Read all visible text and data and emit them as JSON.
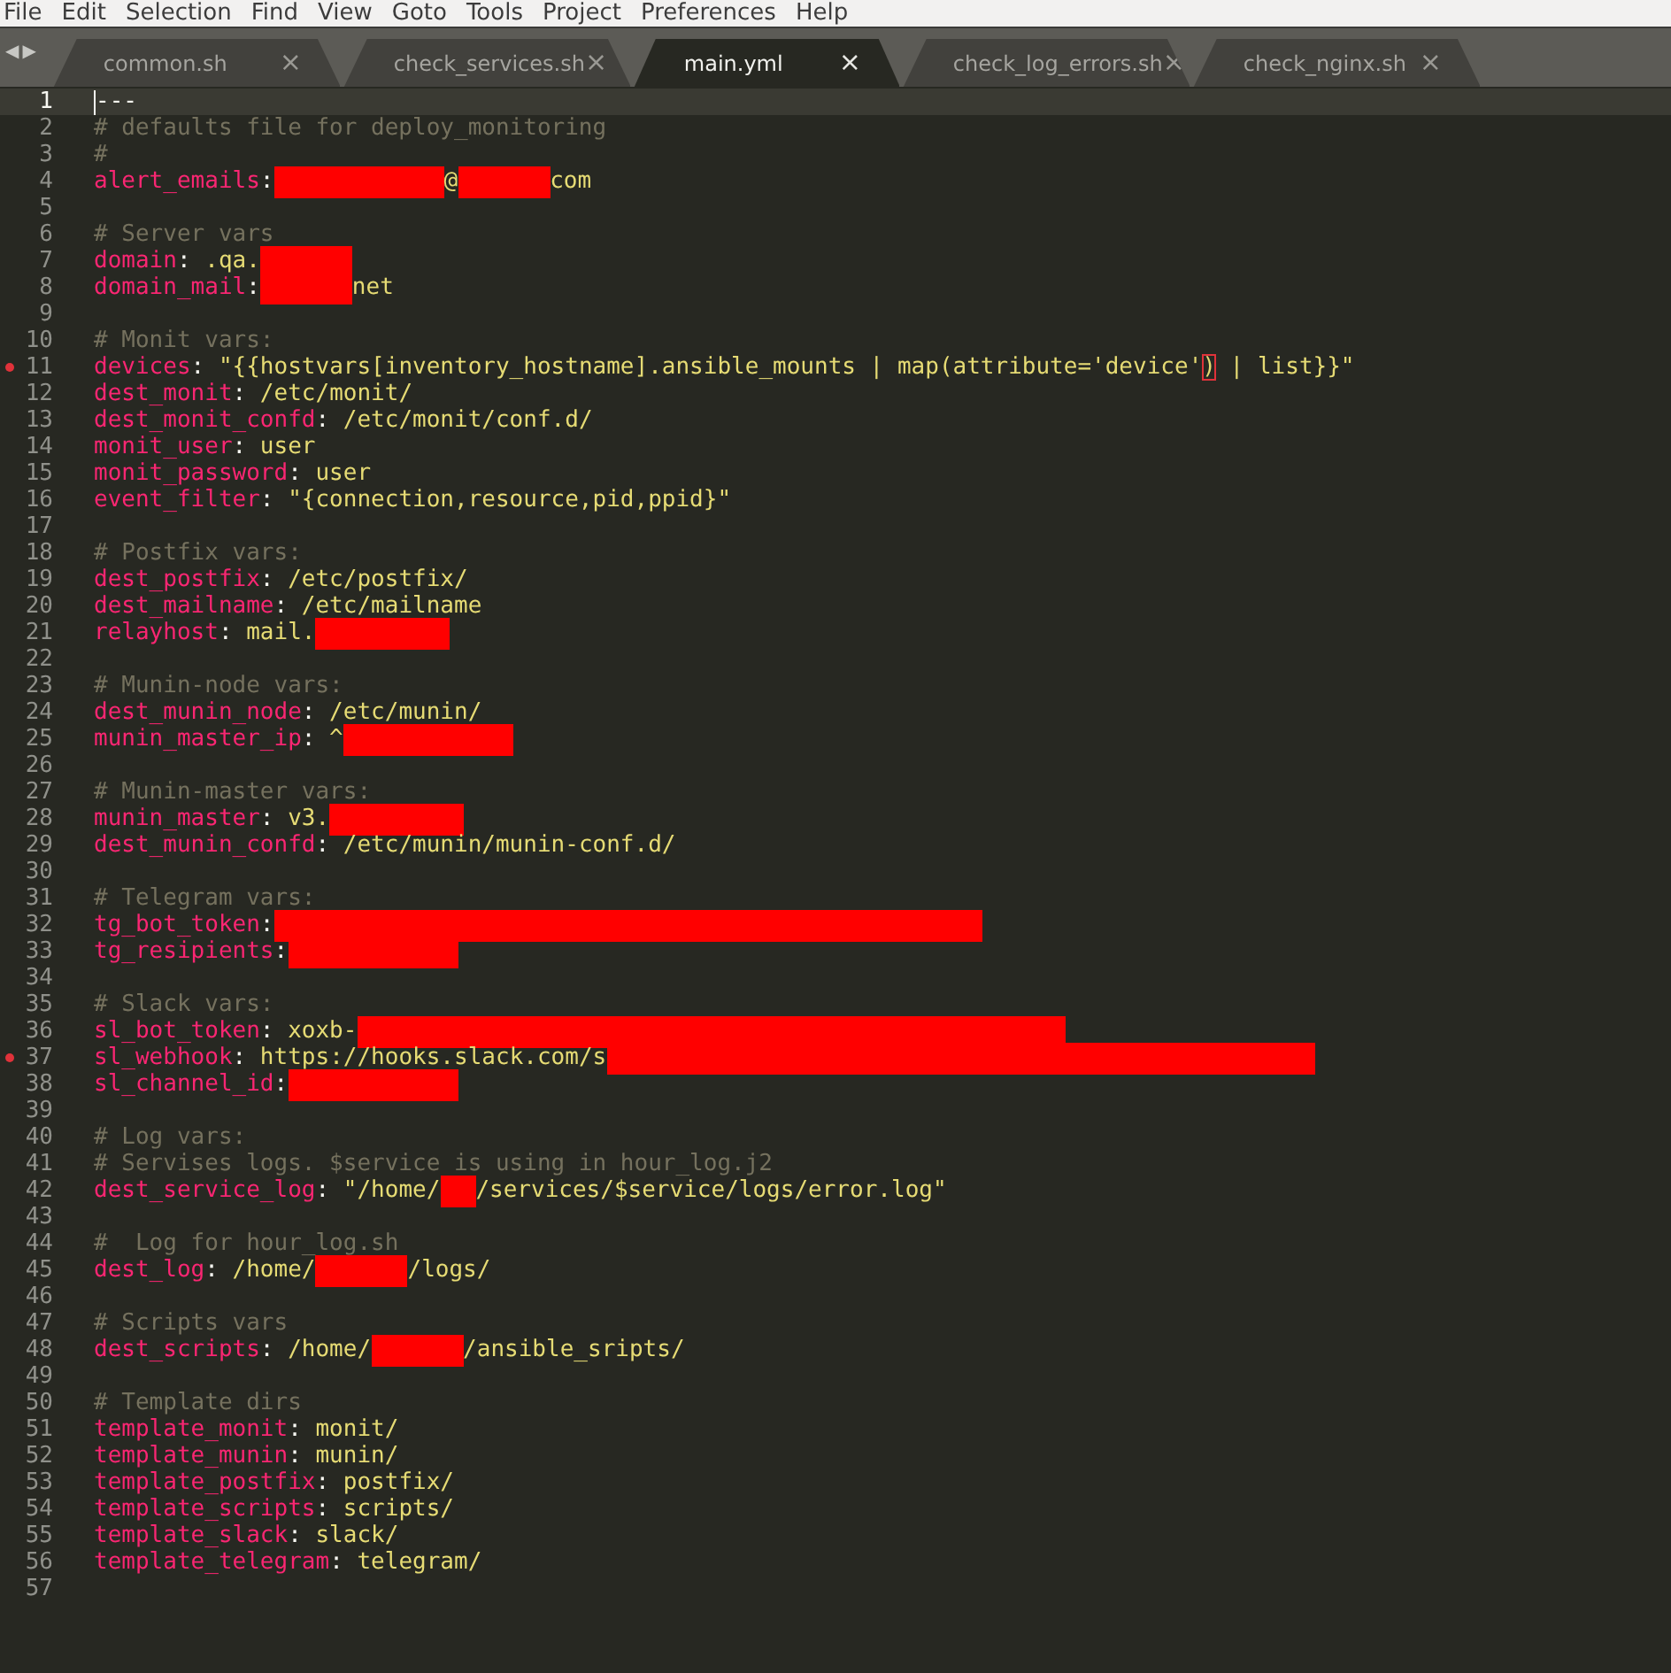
{
  "menu": [
    "File",
    "Edit",
    "Selection",
    "Find",
    "View",
    "Goto",
    "Tools",
    "Project",
    "Preferences",
    "Help"
  ],
  "tab_nav": [
    "◀",
    "▶"
  ],
  "tabs": [
    {
      "label": "common.sh",
      "close": "×",
      "selected": false
    },
    {
      "label": "check_services.sh",
      "close": "×",
      "selected": false
    },
    {
      "label": "main.yml",
      "close": "×",
      "selected": true
    },
    {
      "label": "check_log_errors.sh",
      "close": "×",
      "selected": false
    },
    {
      "label": "check_nginx.sh",
      "close": "×",
      "selected": false
    }
  ],
  "editor": {
    "lines": [
      {
        "number": "1",
        "current": true,
        "segments": [
          {
            "kind": "plain",
            "text": "---"
          }
        ]
      },
      {
        "number": "2",
        "segments": [
          {
            "kind": "comment",
            "text": "# defaults file for deploy_monitoring"
          }
        ]
      },
      {
        "number": "3",
        "segments": [
          {
            "kind": "comment",
            "text": "#"
          }
        ]
      },
      {
        "number": "4",
        "segments": [
          {
            "kind": "key",
            "text": "alert_emails"
          },
          {
            "kind": "punct",
            "text": ":"
          },
          {
            "kind": "redacted-long"
          },
          {
            "kind": "value",
            "text": "@"
          },
          {
            "kind": "redacted-short"
          },
          {
            "kind": "value",
            "text": "com"
          }
        ]
      },
      {
        "number": "5"
      },
      {
        "number": "6",
        "segments": [
          {
            "kind": "comment",
            "text": "# Server vars"
          }
        ]
      },
      {
        "number": "7",
        "segments": [
          {
            "kind": "key",
            "text": "domain"
          },
          {
            "kind": "punct",
            "text": ":"
          },
          {
            "kind": "value",
            "text": " .qa."
          },
          {
            "kind": "redacted-short"
          }
        ]
      },
      {
        "number": "8",
        "segments": [
          {
            "kind": "key",
            "text": "domain_mail"
          },
          {
            "kind": "punct",
            "text": ":"
          },
          {
            "kind": "redacted-short"
          },
          {
            "kind": "value",
            "text": "net"
          }
        ]
      },
      {
        "number": "9"
      },
      {
        "number": "10",
        "segments": [
          {
            "kind": "comment",
            "text": "# Monit vars:"
          }
        ]
      },
      {
        "number": "11",
        "marker": true,
        "segments": [
          {
            "kind": "key",
            "text": "devices"
          },
          {
            "kind": "punct",
            "text": ":"
          },
          {
            "kind": "value",
            "text": " \"{{hostvars[inventory_hostname].ansible_mounts | map(attribute='device'"
          },
          {
            "kind": "bracket",
            "text": ")"
          },
          {
            "kind": "value",
            "text": " | list}}\""
          }
        ]
      },
      {
        "number": "12",
        "segments": [
          {
            "kind": "key",
            "text": "dest_monit"
          },
          {
            "kind": "punct",
            "text": ":"
          },
          {
            "kind": "value",
            "text": " /etc/monit/"
          }
        ]
      },
      {
        "number": "13",
        "segments": [
          {
            "kind": "key",
            "text": "dest_monit_confd"
          },
          {
            "kind": "punct",
            "text": ":"
          },
          {
            "kind": "value",
            "text": " /etc/monit/conf.d/"
          }
        ]
      },
      {
        "number": "14",
        "segments": [
          {
            "kind": "key",
            "text": "monit_user"
          },
          {
            "kind": "punct",
            "text": ":"
          },
          {
            "kind": "value",
            "text": " user"
          }
        ]
      },
      {
        "number": "15",
        "segments": [
          {
            "kind": "key",
            "text": "monit_password"
          },
          {
            "kind": "punct",
            "text": ":"
          },
          {
            "kind": "value",
            "text": " user"
          }
        ]
      },
      {
        "number": "16",
        "segments": [
          {
            "kind": "key",
            "text": "event_filter"
          },
          {
            "kind": "punct",
            "text": ":"
          },
          {
            "kind": "value",
            "text": " \"{connection,resource,pid,ppid}\""
          }
        ]
      },
      {
        "number": "17"
      },
      {
        "number": "18",
        "segments": [
          {
            "kind": "comment",
            "text": "# Postfix vars:"
          }
        ]
      },
      {
        "number": "19",
        "segments": [
          {
            "kind": "key",
            "text": "dest_postfix"
          },
          {
            "kind": "punct",
            "text": ":"
          },
          {
            "kind": "value",
            "text": " /etc/postfix/"
          }
        ]
      },
      {
        "number": "20",
        "segments": [
          {
            "kind": "key",
            "text": "dest_mailname"
          },
          {
            "kind": "punct",
            "text": ":"
          },
          {
            "kind": "value",
            "text": " /etc/mailname"
          }
        ]
      },
      {
        "number": "21",
        "segments": [
          {
            "kind": "key",
            "text": "relayhost"
          },
          {
            "kind": "punct",
            "text": ":"
          },
          {
            "kind": "value",
            "text": " mail."
          },
          {
            "kind": "redacted-medium"
          }
        ]
      },
      {
        "number": "22"
      },
      {
        "number": "23",
        "segments": [
          {
            "kind": "comment",
            "text": "# Munin-node vars:"
          }
        ]
      },
      {
        "number": "24",
        "segments": [
          {
            "kind": "key",
            "text": "dest_munin_node"
          },
          {
            "kind": "punct",
            "text": ":"
          },
          {
            "kind": "value",
            "text": " /etc/munin/"
          }
        ]
      },
      {
        "number": "25",
        "segments": [
          {
            "kind": "key",
            "text": "munin_master_ip"
          },
          {
            "kind": "punct",
            "text": ":"
          },
          {
            "kind": "value",
            "text": " ^"
          },
          {
            "kind": "redacted-long"
          }
        ]
      },
      {
        "number": "26"
      },
      {
        "number": "27",
        "segments": [
          {
            "kind": "comment",
            "text": "# Munin-master vars:"
          }
        ]
      },
      {
        "number": "28",
        "segments": [
          {
            "kind": "key",
            "text": "munin_master"
          },
          {
            "kind": "punct",
            "text": ":"
          },
          {
            "kind": "value",
            "text": " v3."
          },
          {
            "kind": "redacted-medium"
          }
        ]
      },
      {
        "number": "29",
        "segments": [
          {
            "kind": "key",
            "text": "dest_munin_confd"
          },
          {
            "kind": "punct",
            "text": ":"
          },
          {
            "kind": "value",
            "text": " /etc/munin/munin-conf.d/"
          }
        ]
      },
      {
        "number": "30"
      },
      {
        "number": "31",
        "segments": [
          {
            "kind": "comment",
            "text": "# Telegram vars:"
          }
        ]
      },
      {
        "number": "32",
        "segments": [
          {
            "kind": "key",
            "text": "tg_bot_token"
          },
          {
            "kind": "punct",
            "text": ":"
          },
          {
            "kind": "redacted-huge"
          }
        ]
      },
      {
        "number": "33",
        "segments": [
          {
            "kind": "key",
            "text": "tg_resipients"
          },
          {
            "kind": "punct",
            "text": ":"
          },
          {
            "kind": "redacted-long"
          }
        ]
      },
      {
        "number": "34"
      },
      {
        "number": "35",
        "segments": [
          {
            "kind": "comment",
            "text": "# Slack vars:"
          }
        ]
      },
      {
        "number": "36",
        "segments": [
          {
            "kind": "key",
            "text": "sl_bot_token"
          },
          {
            "kind": "punct",
            "text": ":"
          },
          {
            "kind": "value",
            "text": " xoxb-"
          },
          {
            "kind": "redacted-huge"
          }
        ]
      },
      {
        "number": "37",
        "marker": true,
        "segments": [
          {
            "kind": "key",
            "text": "sl_webhook"
          },
          {
            "kind": "punct",
            "text": ":"
          },
          {
            "kind": "value",
            "text": " https://hooks.slack.com/s"
          },
          {
            "kind": "redacted-huge"
          }
        ]
      },
      {
        "number": "38",
        "segments": [
          {
            "kind": "key",
            "text": "sl_channel_id"
          },
          {
            "kind": "punct",
            "text": ":"
          },
          {
            "kind": "redacted-long"
          }
        ]
      },
      {
        "number": "39"
      },
      {
        "number": "40",
        "segments": [
          {
            "kind": "comment",
            "text": "# Log vars:"
          }
        ]
      },
      {
        "number": "41",
        "segments": [
          {
            "kind": "comment",
            "text": "# Servises logs. $service is using in hour_log.j2"
          }
        ]
      },
      {
        "number": "42",
        "segments": [
          {
            "kind": "key",
            "text": "dest_service_log"
          },
          {
            "kind": "punct",
            "text": ":"
          },
          {
            "kind": "value",
            "text": " \"/home/"
          },
          {
            "kind": "redacted-tiny"
          },
          {
            "kind": "value",
            "text": "/services/$service/logs/error.log\""
          }
        ]
      },
      {
        "number": "43"
      },
      {
        "number": "44",
        "segments": [
          {
            "kind": "comment",
            "text": "#  Log for hour_log.sh"
          }
        ]
      },
      {
        "number": "45",
        "segments": [
          {
            "kind": "key",
            "text": "dest_log"
          },
          {
            "kind": "punct",
            "text": ":"
          },
          {
            "kind": "value",
            "text": " /home/"
          },
          {
            "kind": "redacted-short"
          },
          {
            "kind": "value",
            "text": "/logs/"
          }
        ]
      },
      {
        "number": "46"
      },
      {
        "number": "47",
        "segments": [
          {
            "kind": "comment",
            "text": "# Scripts vars"
          }
        ]
      },
      {
        "number": "48",
        "segments": [
          {
            "kind": "key",
            "text": "dest_scripts"
          },
          {
            "kind": "punct",
            "text": ":"
          },
          {
            "kind": "value",
            "text": " /home/"
          },
          {
            "kind": "redacted-short"
          },
          {
            "kind": "value",
            "text": "/ansible_sripts/"
          }
        ]
      },
      {
        "number": "49"
      },
      {
        "number": "50",
        "segments": [
          {
            "kind": "comment",
            "text": "# Template dirs"
          }
        ]
      },
      {
        "number": "51",
        "segments": [
          {
            "kind": "key",
            "text": "template_monit"
          },
          {
            "kind": "punct",
            "text": ":"
          },
          {
            "kind": "value",
            "text": " monit/"
          }
        ]
      },
      {
        "number": "52",
        "segments": [
          {
            "kind": "key",
            "text": "template_munin"
          },
          {
            "kind": "punct",
            "text": ":"
          },
          {
            "kind": "value",
            "text": " munin/"
          }
        ]
      },
      {
        "number": "53",
        "segments": [
          {
            "kind": "key",
            "text": "template_postfix"
          },
          {
            "kind": "punct",
            "text": ":"
          },
          {
            "kind": "value",
            "text": " postfix/"
          }
        ]
      },
      {
        "number": "54",
        "segments": [
          {
            "kind": "key",
            "text": "template_scripts"
          },
          {
            "kind": "punct",
            "text": ":"
          },
          {
            "kind": "value",
            "text": " scripts/"
          }
        ]
      },
      {
        "number": "55",
        "segments": [
          {
            "kind": "key",
            "text": "template_slack"
          },
          {
            "kind": "punct",
            "text": ":"
          },
          {
            "kind": "value",
            "text": " slack/"
          }
        ]
      },
      {
        "number": "56",
        "segments": [
          {
            "kind": "key",
            "text": "template_telegram"
          },
          {
            "kind": "punct",
            "text": ":"
          },
          {
            "kind": "value",
            "text": " telegram/"
          }
        ]
      },
      {
        "number": "57"
      }
    ]
  }
}
